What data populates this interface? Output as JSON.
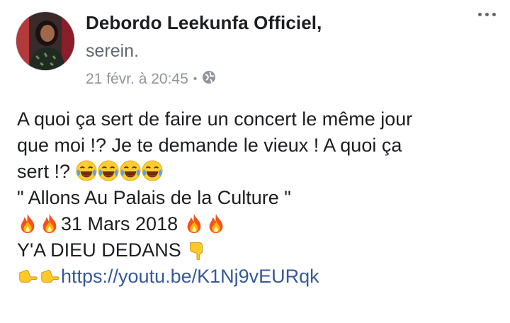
{
  "post": {
    "author": "Debordo Leekunfa Officiel",
    "author_suffix": ",",
    "feeling": "serein.",
    "timestamp": "21 févr. à 20:45",
    "separator": "•",
    "privacy_icon": "globe-icon",
    "menu_icon": "more-options-icon",
    "lines": [
      "A quoi ça sert de faire un concert le même jour",
      "que moi !? Je te demande le vieux ! A quoi ça",
      "sert !?",
      "\" Allons Au Palais de la Culture \"",
      "31 Mars 2018",
      "Y'A DIEU DEDANS",
      "https://youtu.be/K1Nj9vEURqk"
    ],
    "emojis": {
      "laugh_cry": "face-with-tears-of-joy-icon",
      "fire": "fire-icon",
      "point_down": "backhand-index-pointing-down-icon",
      "point_right": "backhand-index-pointing-right-icon"
    }
  }
}
